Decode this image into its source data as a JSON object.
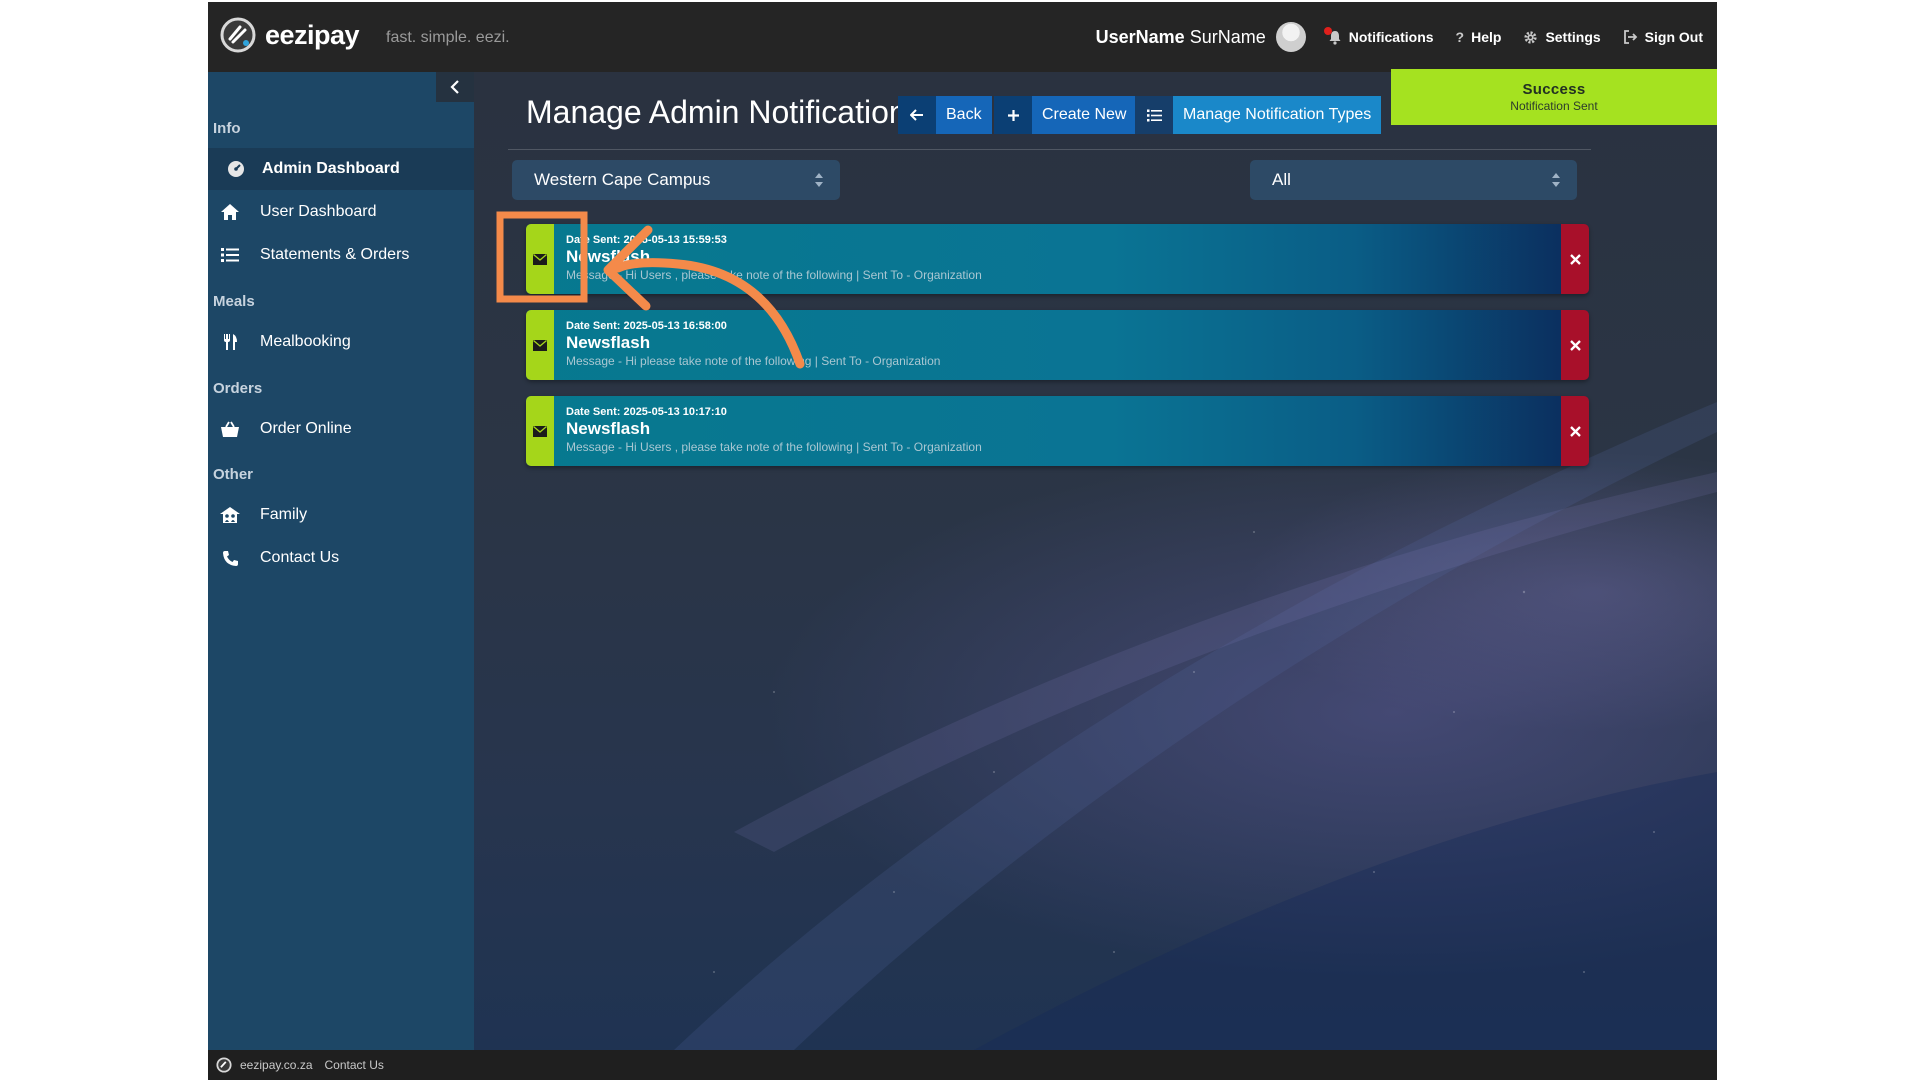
{
  "header": {
    "brand": "eezipay",
    "tagline": "fast. simple. eezi.",
    "user_first": "UserName",
    "user_last": "SurName",
    "links": [
      "Notifications",
      "Help",
      "Settings",
      "Sign Out"
    ]
  },
  "sidebar": {
    "sections": {
      "info": "Info",
      "meals": "Meals",
      "orders": "Orders",
      "other": "Other"
    },
    "items": [
      {
        "label": "Admin Dashboard",
        "icon": "dashboard-icon",
        "active": true
      },
      {
        "label": "User Dashboard",
        "icon": "home-icon"
      },
      {
        "label": "Statements & Orders",
        "icon": "list-icon"
      },
      {
        "label": "Mealbooking",
        "icon": "utensils-icon"
      },
      {
        "label": "Order Online",
        "icon": "basket-icon"
      },
      {
        "label": "Family",
        "icon": "family-icon"
      },
      {
        "label": "Contact Us",
        "icon": "phone-icon"
      }
    ]
  },
  "main": {
    "title": "Manage Admin Notifications",
    "buttons": {
      "back": "Back",
      "create": "Create New",
      "types": "Manage Notification Types"
    },
    "filters": {
      "campus": "Western Cape Campus",
      "type": "All"
    },
    "notifications": [
      {
        "date": "Date Sent: 2025-05-13 15:59:53",
        "title": "Newsflash",
        "message": "Message - Hi Users , please take note of the following | Sent To - Organization"
      },
      {
        "date": "Date Sent: 2025-05-13 16:58:00",
        "title": "Newsflash",
        "message": "Message - Hi please take note of the following | Sent To - Organization"
      },
      {
        "date": "Date Sent: 2025-05-13 10:17:10",
        "title": "Newsflash",
        "message": "Message - Hi Users , please take note of the following | Sent To - Organization"
      }
    ]
  },
  "toast": {
    "title": "Success",
    "message": "Notification Sent"
  },
  "footer": {
    "site": "eezipay.co.za",
    "contact": "Contact Us"
  },
  "colors": {
    "header_bg": "#252525",
    "sidebar_bg": "#1d4766",
    "accent_green": "#a5d61a",
    "delete_red": "#a8102a",
    "callout_orange": "#f48a4a"
  }
}
